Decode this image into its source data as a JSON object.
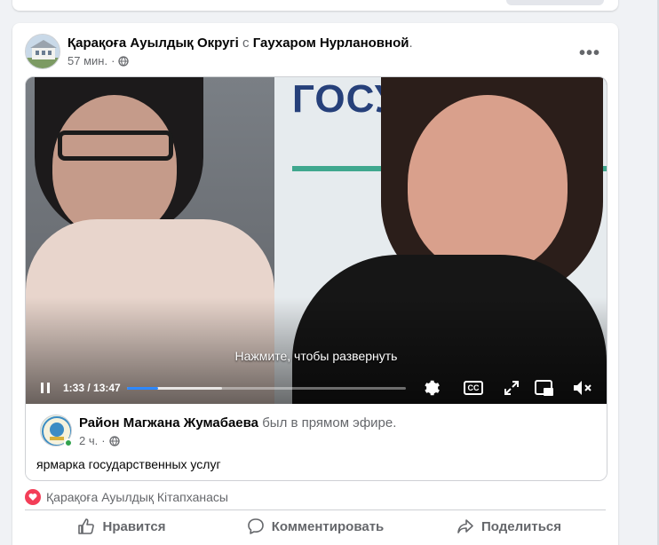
{
  "post": {
    "author": "Қарақоға Ауылдық Округі",
    "with_text": "с",
    "tagged": "Гаухаром Нурлановной",
    "tagged_suffix": ".",
    "time": "57 мин.",
    "dot": "·",
    "more": "•••"
  },
  "video": {
    "banner_text": "ГОСУД",
    "expand_hint": "Нажмите, чтобы развернуть",
    "time_display": "1:33 / 13:47",
    "progress_fraction": 0.1124,
    "buffered_fraction": 0.34,
    "cc_label": "CC"
  },
  "shared_live": {
    "author": "Район Магжана Жумабаева",
    "status": "был в прямом эфире.",
    "time": "2 ч.",
    "dot": "·",
    "description": "ярмарка государственных услуг"
  },
  "reactions": {
    "names": "Қарақоға Ауылдық Кітапханасы"
  },
  "actions": {
    "like": "Нравится",
    "comment": "Комментировать",
    "share": "Поделиться"
  },
  "colors": {
    "brand_blue": "#2d88ff",
    "heart": "#f33e58",
    "online": "#31a24c",
    "secondary_text": "#65676b"
  }
}
